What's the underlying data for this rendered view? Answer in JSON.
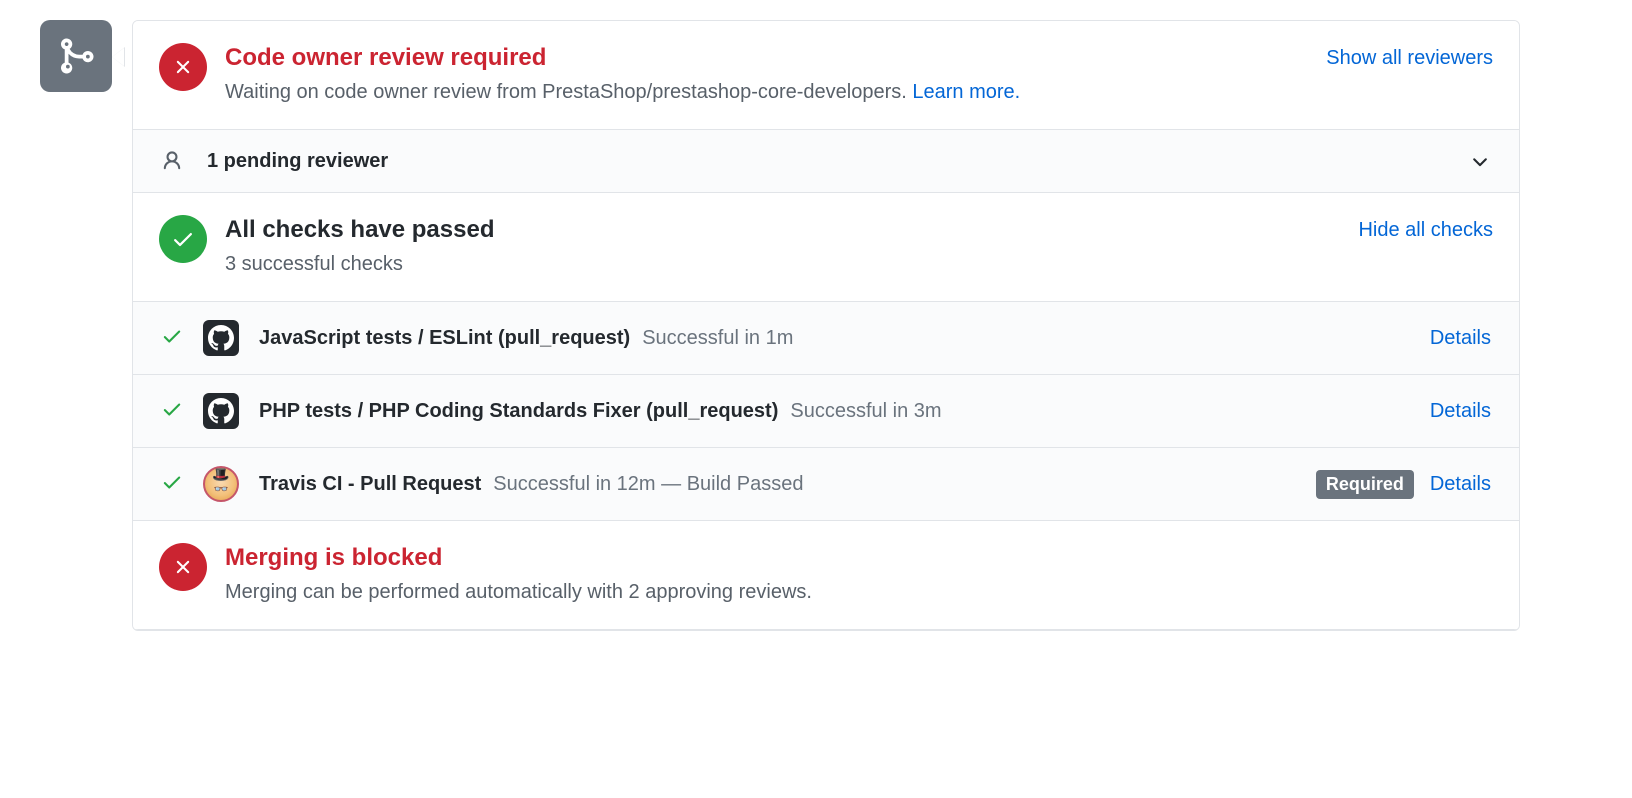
{
  "review": {
    "title": "Code owner review required",
    "subtext_prefix": "Waiting on code owner review from PrestaShop/prestashop-core-developers. ",
    "learn_more": "Learn more.",
    "show_all": "Show all reviewers"
  },
  "pending": {
    "label": "1 pending reviewer"
  },
  "checks": {
    "title": "All checks have passed",
    "subtext": "3 successful checks",
    "hide_all": "Hide all checks",
    "items": [
      {
        "avatar": "github",
        "name": "JavaScript tests / ESLint (pull_request)",
        "status": "Successful in 1m",
        "required": false
      },
      {
        "avatar": "github",
        "name": "PHP tests / PHP Coding Standards Fixer (pull_request)",
        "status": "Successful in 3m",
        "required": false
      },
      {
        "avatar": "travis",
        "name": "Travis CI - Pull Request",
        "status": "Successful in 12m — Build Passed",
        "required": true
      }
    ],
    "details_label": "Details",
    "required_label": "Required"
  },
  "blocked": {
    "title": "Merging is blocked",
    "subtext": "Merging can be performed automatically with 2 approving reviews."
  }
}
